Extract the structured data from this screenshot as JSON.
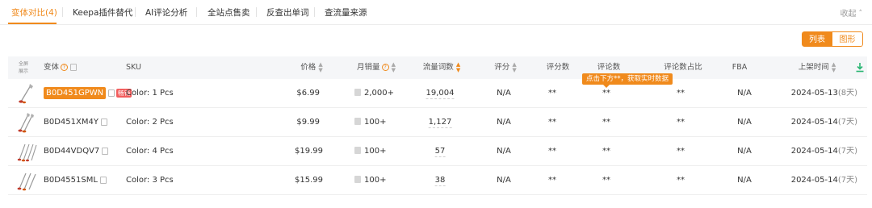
{
  "tabs": [
    {
      "label": "变体对比(4)",
      "active": true
    },
    {
      "label": "Keepa插件替代"
    },
    {
      "label": "AI评论分析"
    },
    {
      "label": "全站点售卖"
    },
    {
      "label": "反查出单词"
    },
    {
      "label": "查流量来源"
    }
  ],
  "collapse_label": "收起",
  "view_toggle": {
    "list": "列表",
    "chart": "图形",
    "selected": "列表"
  },
  "table": {
    "fullscreen_label": [
      "全屏",
      "展示"
    ],
    "headers": {
      "variant": "变体",
      "sku": "SKU",
      "price": "价格",
      "monthly_sales": "月销量",
      "traffic_words": "流量词数",
      "rating": "评分",
      "rating_count": "评分数",
      "reviews": "评论数",
      "review_share": "评论数占比",
      "fba": "FBA",
      "listing_date": "上架时间"
    },
    "rows": [
      {
        "asin": "B0D451GPWN",
        "tag": "畅销",
        "sku": "Color: 1 Pcs",
        "price": "$6.99",
        "sales": "2,000+",
        "traffic": "19,004",
        "rating": "N/A",
        "rating_count": "**",
        "reviews": "**",
        "review_share": "**",
        "fba": "N/A",
        "date": "2024-05-13",
        "days": "(8天)",
        "highlight": true
      },
      {
        "asin": "B0D451XM4Y",
        "sku": "Color: 2 Pcs",
        "price": "$9.99",
        "sales": "100+",
        "traffic": "1,127",
        "rating": "N/A",
        "rating_count": "**",
        "reviews": "**",
        "review_share": "**",
        "fba": "N/A",
        "date": "2024-05-14",
        "days": "(7天)"
      },
      {
        "asin": "B0D44VDQV7",
        "sku": "Color: 4 Pcs",
        "price": "$19.99",
        "sales": "100+",
        "traffic": "57",
        "rating": "N/A",
        "rating_count": "**",
        "reviews": "**",
        "review_share": "**",
        "fba": "N/A",
        "date": "2024-05-14",
        "days": "(7天)"
      },
      {
        "asin": "B0D4551SML",
        "sku": "Color: 3 Pcs",
        "price": "$15.99",
        "sales": "100+",
        "traffic": "38",
        "rating": "N/A",
        "rating_count": "**",
        "reviews": "**",
        "review_share": "**",
        "fba": "N/A",
        "date": "2024-05-14",
        "days": "(7天)"
      }
    ]
  },
  "tooltip": "点击下方**，获取实时数据",
  "colors": {
    "accent": "#f08a1c",
    "hot_tag": "#f25d5d",
    "header_bg": "#f5f6f8",
    "download_icon": "#2bb673"
  }
}
